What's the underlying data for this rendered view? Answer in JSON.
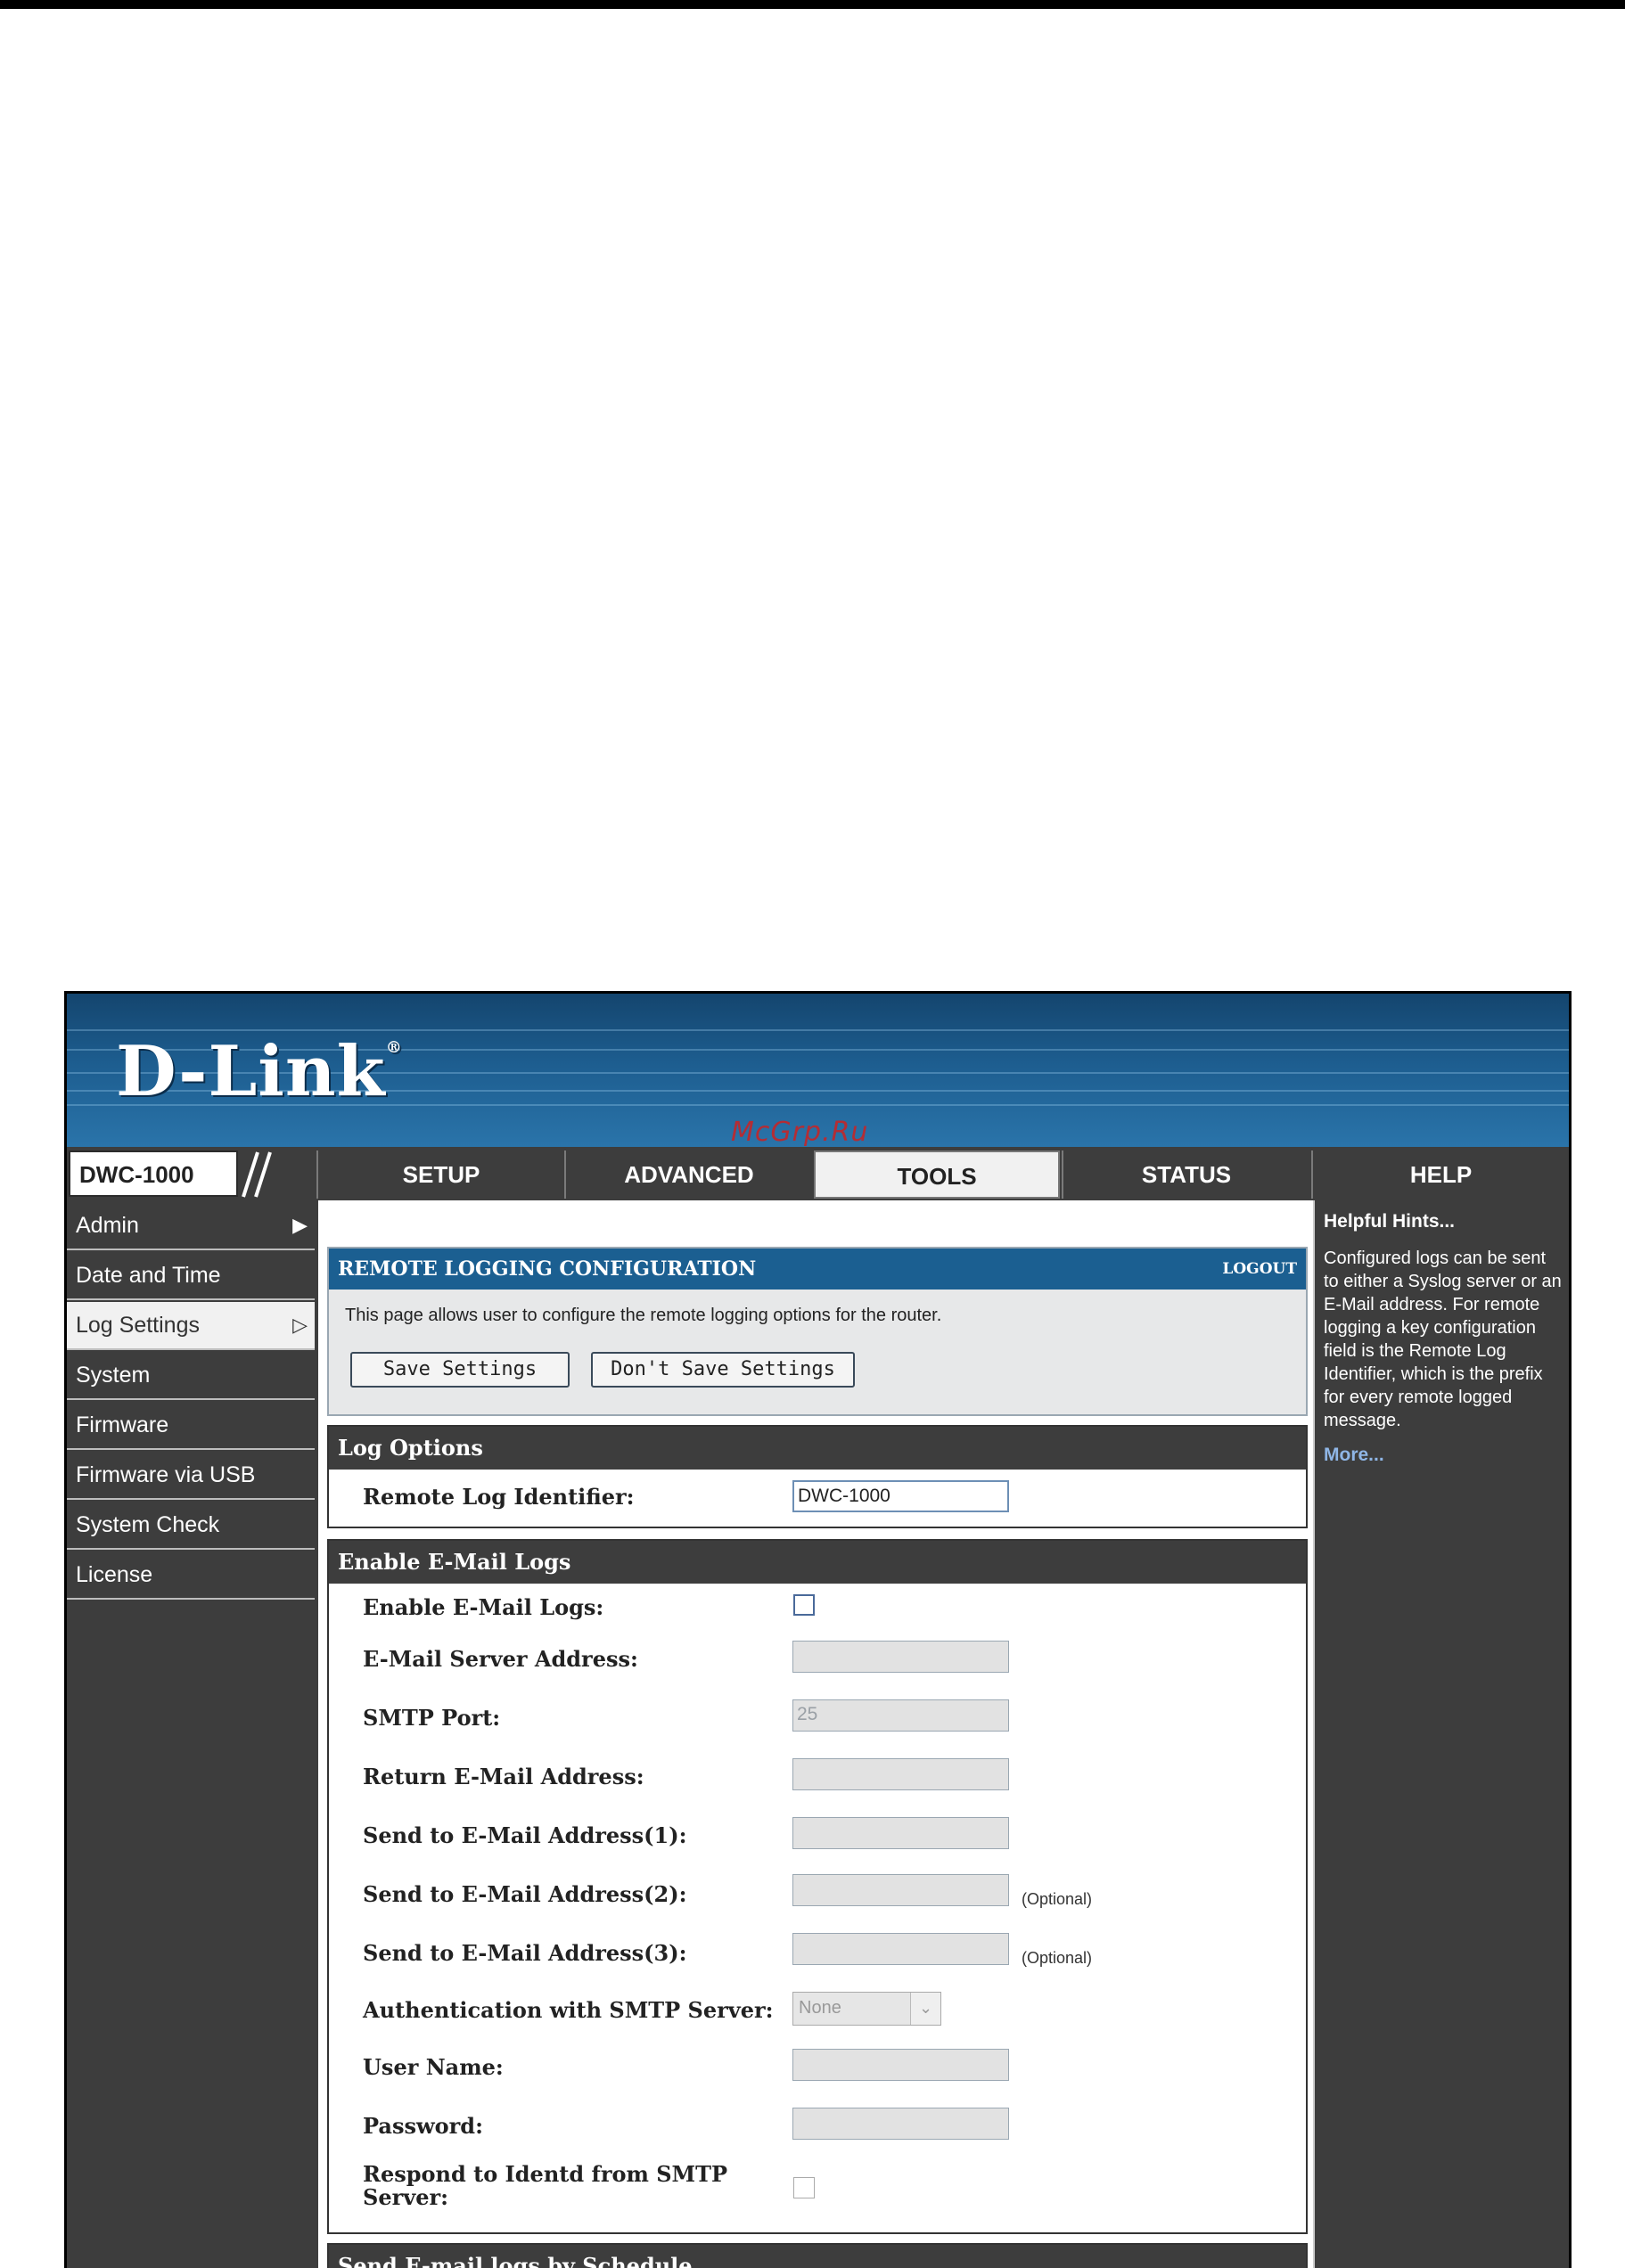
{
  "watermark": "McGrp.Ru",
  "brand": {
    "logo_text": "D-Link",
    "reg_mark": "®"
  },
  "model": "DWC-1000",
  "tabs": [
    {
      "label": "SETUP",
      "active": false
    },
    {
      "label": "ADVANCED",
      "active": false
    },
    {
      "label": "TOOLS",
      "active": true
    },
    {
      "label": "STATUS",
      "active": false
    },
    {
      "label": "HELP",
      "active": false
    }
  ],
  "sidebar": {
    "items": [
      {
        "label": "Admin",
        "arrow": "▶"
      },
      {
        "label": "Date and Time",
        "arrow": ""
      },
      {
        "label": "Log Settings",
        "arrow": "▷"
      },
      {
        "label": "System",
        "arrow": ""
      },
      {
        "label": "Firmware",
        "arrow": ""
      },
      {
        "label": "Firmware via USB",
        "arrow": ""
      },
      {
        "label": "System Check",
        "arrow": ""
      },
      {
        "label": "License",
        "arrow": ""
      }
    ]
  },
  "config": {
    "title": "REMOTE LOGGING CONFIGURATION",
    "logout": "LOGOUT",
    "description": "This page allows user to configure the remote logging options for the router.",
    "save_label": "Save Settings",
    "dont_save_label": "Don't Save Settings"
  },
  "log_options": {
    "title": "Log Options",
    "identifier_label": "Remote Log Identifier:",
    "identifier_value": "DWC-1000"
  },
  "email_logs": {
    "title": "Enable E-Mail Logs",
    "enable_label": "Enable E-Mail Logs:",
    "server_label": "E-Mail Server Address:",
    "smtp_port_label": "SMTP Port:",
    "smtp_port_value": "25",
    "return_label": "Return E-Mail Address:",
    "send1_label": "Send to E-Mail Address(1):",
    "send2_label": "Send to E-Mail Address(2):",
    "send3_label": "Send to E-Mail Address(3):",
    "optional_text": "(Optional)",
    "auth_label": "Authentication with SMTP Server:",
    "auth_value": "None",
    "username_label": "User Name:",
    "password_label": "Password:",
    "identd_label_1": "Respond to Identd from SMTP",
    "identd_label_2": "Server:"
  },
  "schedule": {
    "title": "Send E-mail logs by Schedule"
  },
  "help": {
    "title": "Helpful Hints...",
    "body": "Configured logs can be sent to either a Syslog server or an E-Mail address. For remote logging a key configuration field is the Remote Log Identifier, which is the prefix for every remote logged message.",
    "more": "More..."
  }
}
